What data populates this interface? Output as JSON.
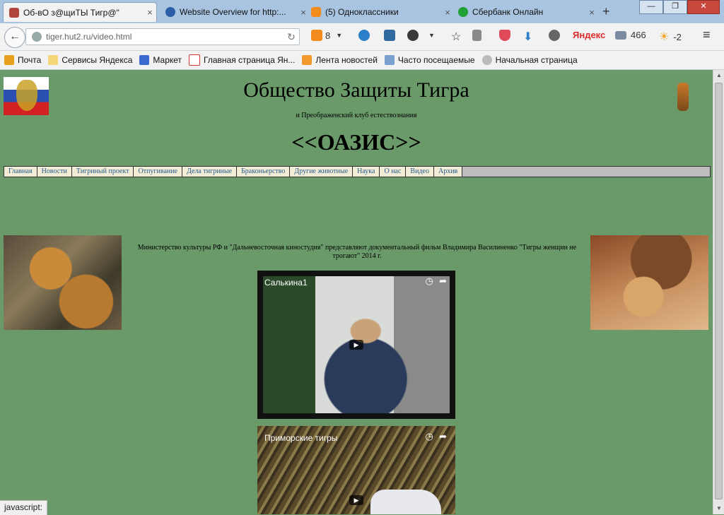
{
  "browser": {
    "tabs": [
      {
        "title": "Об-вО з@щиТЫ Тигр@\"",
        "fav_color": "#b0453b",
        "close": "×"
      },
      {
        "title": "Website Overview for http:...",
        "fav_color": "#2b5fa8",
        "close": "×"
      },
      {
        "title": "(5) Одноклассники",
        "fav_color": "#f28c1e",
        "close": "×"
      },
      {
        "title": "Сбербанк Онлайн",
        "fav_color": "#21a038",
        "close": "×"
      }
    ],
    "new_tab": "+",
    "window_buttons": {
      "minimize": "—",
      "maximize": "❐",
      "close": "✕"
    },
    "back": "←",
    "url": "tiger.hut2.ru/video.html",
    "reload": "↻",
    "ok_count": "8",
    "yandex": "Яндекс",
    "mail_count": "466",
    "weather": "-2",
    "bookmarks": [
      "Почта",
      "Сервисы Яндекса",
      "Маркет",
      "Главная страница Ян...",
      "Лента новостей",
      "Часто посещаемые",
      "Начальная страница"
    ],
    "status": "javascript:"
  },
  "site": {
    "title": "Общество Защиты Тигра",
    "subtitle": "и Преображенский клуб естествознания",
    "club": "<<ОАЗИС>>",
    "menu": [
      "Главная",
      "Новости",
      "Тигриный проект",
      "Отпугивание",
      "Дела тигриные",
      "Браконьерство",
      "Другие животные",
      "Наука",
      "О нас",
      "Видео",
      "Архив"
    ],
    "caption": "Министерство культуры РФ и \"Дальневосточная киностудия\" представляют документальный фильм Владимира Василиненко \"Тигры женщин не трогают\" 2014 г.",
    "videos": [
      {
        "title": "Салькина1",
        "play": "▶"
      },
      {
        "title": "Приморские тигры",
        "play": "▶"
      }
    ]
  },
  "icons": [
    "back-icon",
    "globe-icon",
    "reload-icon",
    "star-icon",
    "download-icon",
    "mail-icon",
    "weather-icon",
    "menu-icon",
    "clock-icon",
    "share-icon"
  ]
}
